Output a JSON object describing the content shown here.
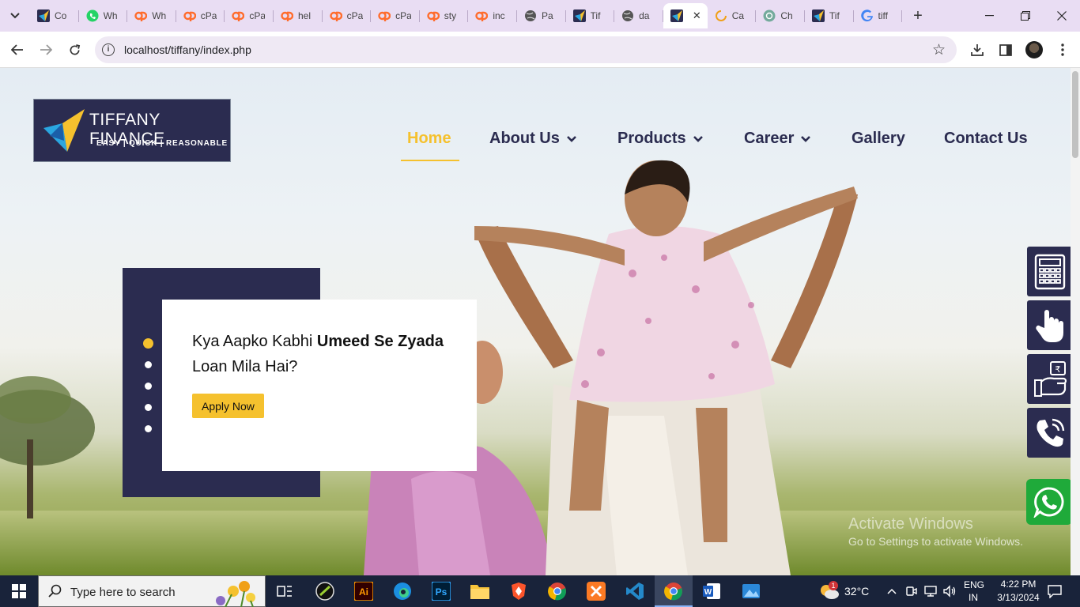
{
  "browser": {
    "tabs": [
      {
        "title": "Co",
        "icon": "tiffany-favicon"
      },
      {
        "title": "Wh",
        "icon": "whatsapp-icon"
      },
      {
        "title": "Wh",
        "icon": "cpanel-icon"
      },
      {
        "title": "cPa",
        "icon": "cpanel-icon"
      },
      {
        "title": "cPa",
        "icon": "cpanel-icon"
      },
      {
        "title": "hel",
        "icon": "cpanel-icon"
      },
      {
        "title": "cPa",
        "icon": "cpanel-icon"
      },
      {
        "title": "cPa",
        "icon": "cpanel-icon"
      },
      {
        "title": "sty",
        "icon": "cpanel-icon"
      },
      {
        "title": "inc",
        "icon": "cpanel-icon"
      },
      {
        "title": "Pa",
        "icon": "globe-icon"
      },
      {
        "title": "Tif",
        "icon": "tiffany-favicon"
      },
      {
        "title": "da",
        "icon": "globe-icon"
      },
      {
        "title": "",
        "icon": "tiffany-favicon",
        "active": true
      },
      {
        "title": "Ca",
        "icon": "loading-icon"
      },
      {
        "title": "Ch",
        "icon": "chatgpt-icon"
      },
      {
        "title": "Tif",
        "icon": "tiffany-favicon"
      },
      {
        "title": "tiff",
        "icon": "google-icon"
      }
    ],
    "address": {
      "url": "localhost/tiffany/index.php"
    }
  },
  "site": {
    "logo": {
      "name": "TIFFANY FINANCE",
      "tagline": "EASY | QUICK | REASONABLE"
    },
    "nav": {
      "home": "Home",
      "about": "About Us",
      "products": "Products",
      "career": "Career",
      "gallery": "Gallery",
      "contact": "Contact Us"
    },
    "hero": {
      "line_a": "Kya Aapko Kabhi ",
      "line_bold": "Umeed Se Zyada",
      "line_b": "Loan Mila Hai?",
      "button": "Apply Now"
    },
    "side_buttons": [
      "calculator-icon",
      "hand-pointer-icon",
      "rupee-hand-icon",
      "phone-call-icon",
      "whatsapp-icon"
    ]
  },
  "watermark": {
    "title": "Activate Windows",
    "subtitle": "Go to Settings to activate Windows."
  },
  "taskbar": {
    "search_placeholder": "Type here to search",
    "weather": "32°C",
    "lang1": "ENG",
    "lang2": "IN",
    "time": "4:22 PM",
    "date": "3/13/2024",
    "weather_badge": "1"
  },
  "colors": {
    "navy": "#2b2c50",
    "accent": "#f5c12e",
    "whatsapp": "#1faa3a"
  }
}
